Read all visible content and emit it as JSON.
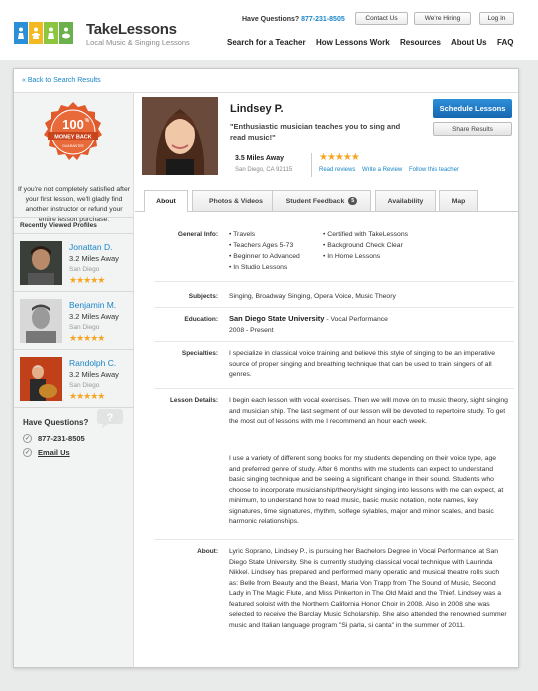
{
  "header": {
    "brand_name": "TakeLessons",
    "brand_tagline": "Local Music & Singing Lessons",
    "questions_label": "Have Questions?",
    "phone": "877-231-8505",
    "contact_label": "Contact Us",
    "hiring_label": "We're Hiring",
    "login_label": "Log In",
    "nav": [
      "Search for a Teacher",
      "How Lessons Work",
      "Resources",
      "About Us",
      "FAQ"
    ],
    "logo_colors": [
      "#2a8fd6",
      "#f3b921",
      "#8cc63f",
      "#6ab04c"
    ]
  },
  "back_link": "« Back to Search Results",
  "sidebar": {
    "badge": {
      "top": "100",
      "sup": "%",
      "middle": "MONEY BACK",
      "bottom": "GUARANTEE"
    },
    "guarantee_text": "If you're not completely satisfied after your first lesson, we'll gladly find another instructor or refund your entire lesson purchase.",
    "recent_title": "Recently Viewed Profiles",
    "recent": [
      {
        "name": "Jonattan D.",
        "distance": "3.2 Miles Away",
        "city": "San Diego",
        "stars": "★★★★★"
      },
      {
        "name": "Benjamin M.",
        "distance": "3.2 Miles Away",
        "city": "San Diego",
        "stars": "★★★★★"
      },
      {
        "name": "Randolph C.",
        "distance": "3.2 Miles Away",
        "city": "San Diego",
        "stars": "★★★★★"
      }
    ],
    "questions_title": "Have Questions?",
    "phone": "877-231-8505",
    "email_label": "Email Us"
  },
  "teacher": {
    "name": "Lindsey P.",
    "tagline": "\"Enthusiastic musician teaches you to sing and read music!\"",
    "distance": "3.5 Miles Away",
    "location": "San Diego, CA 92115",
    "stars": "★★★★★",
    "links": [
      "Read reviews",
      "Write a Review",
      "Follow this teacher"
    ],
    "schedule_label": "Schedule Lessons",
    "share_label": "Share Results"
  },
  "tabs": [
    {
      "label": "About"
    },
    {
      "label": "Photos & Videos"
    },
    {
      "label": "Student Feedback",
      "count": "5"
    },
    {
      "label": "Availability"
    },
    {
      "label": "Map"
    }
  ],
  "about": {
    "general_label": "General Info:",
    "general_col1": [
      "Travels",
      "Teachers Ages 5-73",
      "Beginner to Advanced",
      "In Studio Lessons"
    ],
    "general_col2": [
      "Certified with TakeLessons",
      "Background Check Clear",
      "In Home Lessons"
    ],
    "subjects_label": "Subjects:",
    "subjects": "Singing, Broadway Singing, Opera Voice, Music Theory",
    "education_label": "Education:",
    "education_school": "San Diego State University",
    "education_degree": " - Vocal Performance",
    "education_years": "2008 - Present",
    "specialties_label": "Specialties:",
    "specialties": "I specialize in classical voice training and believe this style of singing to be an imperative source of proper singing and breathing technique that can be used to train singers of all genres.",
    "lesson_label": "Lesson Details:",
    "lesson_p1": "I begin each lesson with vocal exercises. Then we will move on to music theory, sight singing and musician ship. The last segment of our lesson will be devoted to repertoire study. To get the most out of lessons with me I recommend an hour each week.",
    "lesson_p2": "I use a variety of different song books for my students depending on their voice type, age and preferred genre of study. After 6 months with me students can expect to understand basic singing technique and be seeing a significant change in their sound. Students who choose to incorporate musicianship/theory/sight singing into lessons with me can expect, at minimum, to understand how to read music, basic music notation, note names, key signatures, time signatures, rhythm, solfege sylables, major and minor scales, and basic harmonic relationships.",
    "about_label": "About:",
    "about_text": "Lyric Soprano, Lindsey P., is pursuing her Bachelors Degree in Vocal Performance at San Diego State University. She is currently studying classical vocal technique with Laurinda Nikkel. Lindsey has prepared and performed many operatic and musical theatre rolls such as: Belle from Beauty and the Beast, Maria Von Trapp from The Sound of Music, Second Lady in The Magic Flute, and Miss Pinkerton in The Old Maid and the Thief. Lindsey was a featured soloist with the Northern California Honor Choir in 2008. Also in 2008 she was selected to receive the Barclay Music Scholarship. She also attended the renowned summer music and Italian language program \"Si parla, si canta\" in the summer of 2011."
  }
}
